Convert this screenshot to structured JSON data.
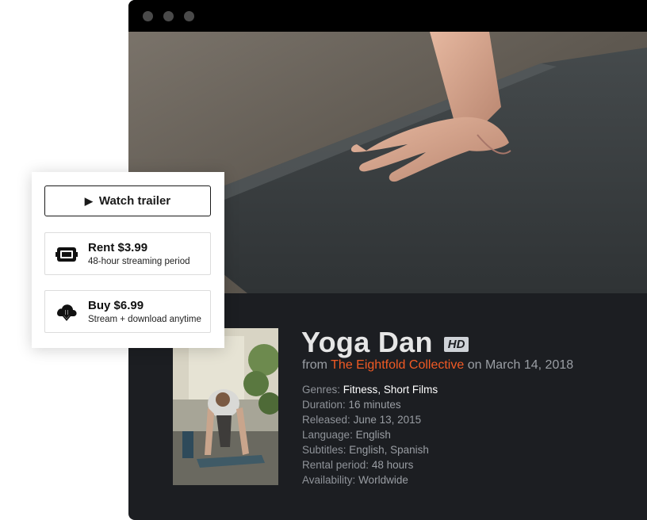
{
  "window": {
    "hero_alt": "",
    "poster_alt": ""
  },
  "film": {
    "title": "Yoga Dan",
    "quality_badge": "HD",
    "from_prefix": "from",
    "studio": "The Eightfold Collective",
    "date_prefix": "on",
    "publish_date": "March 14, 2018"
  },
  "meta": {
    "genres_label": "Genres:",
    "genres": [
      "Fitness",
      "Short Films"
    ],
    "genre_separator": ",",
    "duration_label": "Duration:",
    "duration": "16 minutes",
    "released_label": "Released:",
    "released": "June 13, 2015",
    "language_label": "Language:",
    "language": "English",
    "subtitles_label": "Subtitles:",
    "subtitles": "English, Spanish",
    "rental_label": "Rental period:",
    "rental": "48 hours",
    "availability_label": "Availability:",
    "availability": "Worldwide"
  },
  "card": {
    "trailer_icon": "play-icon",
    "trailer_label": "Watch trailer",
    "rent": {
      "icon": "ticket-icon",
      "price": "Rent $3.99",
      "desc": "48-hour streaming period"
    },
    "buy": {
      "icon": "cloud-download-icon",
      "price": "Buy $6.99",
      "desc": "Stream + download anytime"
    }
  },
  "colors": {
    "accent": "#f15a24",
    "panel": "#1c1e22",
    "titlebar": "#000000"
  }
}
